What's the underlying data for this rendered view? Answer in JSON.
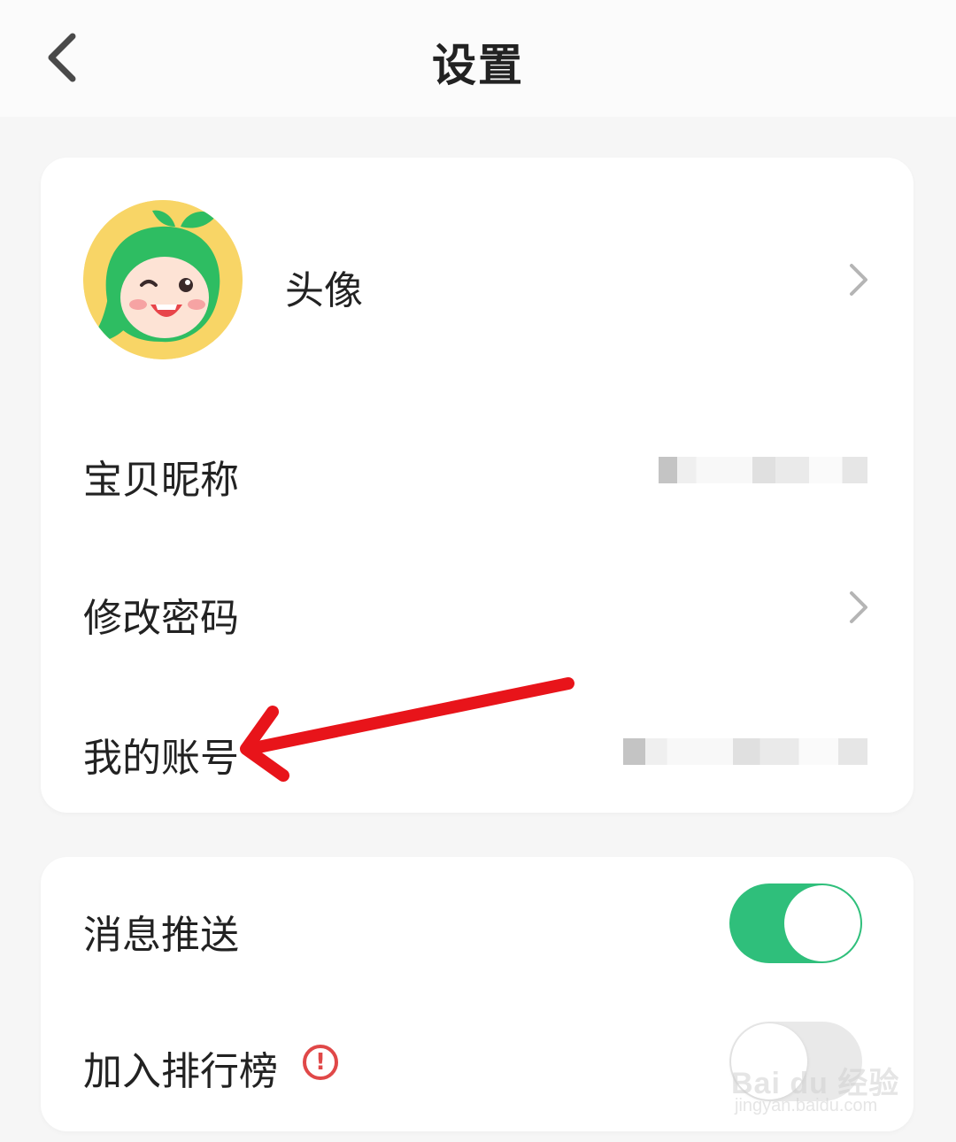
{
  "header": {
    "title": "设置",
    "back_icon": "chevron-left-icon"
  },
  "profile_card": {
    "avatar_label": "头像",
    "nickname_label": "宝贝昵称",
    "password_label": "修改密码",
    "account_label": "我的账号"
  },
  "settings_card": {
    "push_label": "消息推送",
    "push_enabled": true,
    "rank_label": "加入排行榜",
    "rank_enabled": false,
    "info_icon": "alert-circle-icon"
  },
  "watermark": {
    "brand": "Bai du 经验",
    "url": "jingyan.baidu.com"
  },
  "colors": {
    "toggle_on": "#2fbf7b",
    "annotation_arrow": "#e8141a",
    "info_icon": "#e04848",
    "avatar_bg": "#f8d566"
  }
}
